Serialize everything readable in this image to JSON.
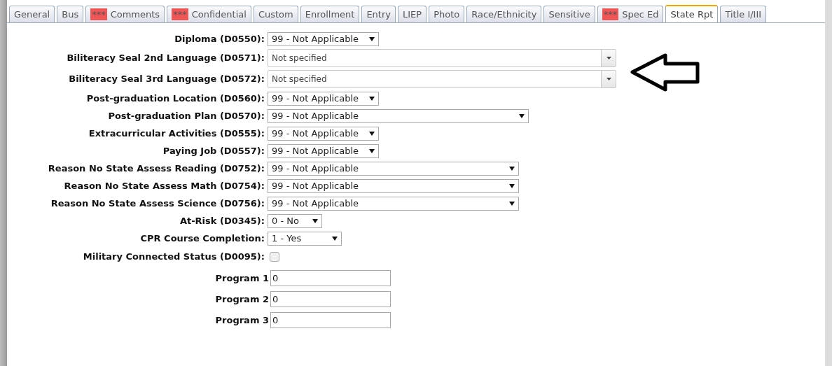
{
  "tabs": [
    {
      "label": "General",
      "selected": false
    },
    {
      "label": "Bus",
      "selected": false
    },
    {
      "label": "Comments",
      "flag": "***",
      "selected": false
    },
    {
      "label": "Confidential",
      "flag": "***",
      "selected": false
    },
    {
      "label": "Custom",
      "selected": false
    },
    {
      "label": "Enrollment",
      "selected": false
    },
    {
      "label": "Entry",
      "selected": false
    },
    {
      "label": "LIEP",
      "selected": false
    },
    {
      "label": "Photo",
      "selected": false
    },
    {
      "label": "Race/Ethnicity",
      "selected": false
    },
    {
      "label": "Sensitive",
      "selected": false
    },
    {
      "label": "Spec Ed",
      "flag": "***",
      "selected": false
    },
    {
      "label": "State Rpt",
      "selected": true
    },
    {
      "label": "Title I/III",
      "selected": false
    }
  ],
  "fields": [
    {
      "kind": "select",
      "label": "Diploma (D0550):",
      "value": "99 - Not Applicable"
    },
    {
      "kind": "combo",
      "label": "Biliteracy Seal 2nd Language (D0571):",
      "value": "Not specified"
    },
    {
      "kind": "combo",
      "label": "Biliteracy Seal 3rd Language (D0572):",
      "value": "Not specified"
    },
    {
      "kind": "select",
      "label": "Post-graduation Location (D0560):",
      "value": "99 - Not Applicable"
    },
    {
      "kind": "select",
      "label": "Post-graduation Plan (D0570):",
      "value": "99 - Not Applicable"
    },
    {
      "kind": "select",
      "label": "Extracurricular Activities (D0555):",
      "value": "99 - Not Applicable"
    },
    {
      "kind": "select",
      "label": "Paying Job (D0557):",
      "value": "99 - Not Applicable"
    },
    {
      "kind": "select",
      "label": "Reason No State Assess Reading (D0752):",
      "value": "99 - Not Applicable"
    },
    {
      "kind": "select",
      "label": "Reason No State Assess Math (D0754):",
      "value": "99 - Not Applicable"
    },
    {
      "kind": "select",
      "label": "Reason No State Assess Science (D0756):",
      "value": "99 - Not Applicable"
    },
    {
      "kind": "select",
      "label": "At-Risk (D0345):",
      "value": "0 - No"
    },
    {
      "kind": "select",
      "label": "CPR Course Completion:",
      "value": "1 - Yes"
    },
    {
      "kind": "checkbox",
      "label": "Military Connected Status (D0095):",
      "checked": false
    },
    {
      "kind": "text",
      "label": "Program 1",
      "value": "0"
    },
    {
      "kind": "text",
      "label": "Program 2",
      "value": "0"
    },
    {
      "kind": "text",
      "label": "Program 3",
      "value": "0"
    }
  ]
}
